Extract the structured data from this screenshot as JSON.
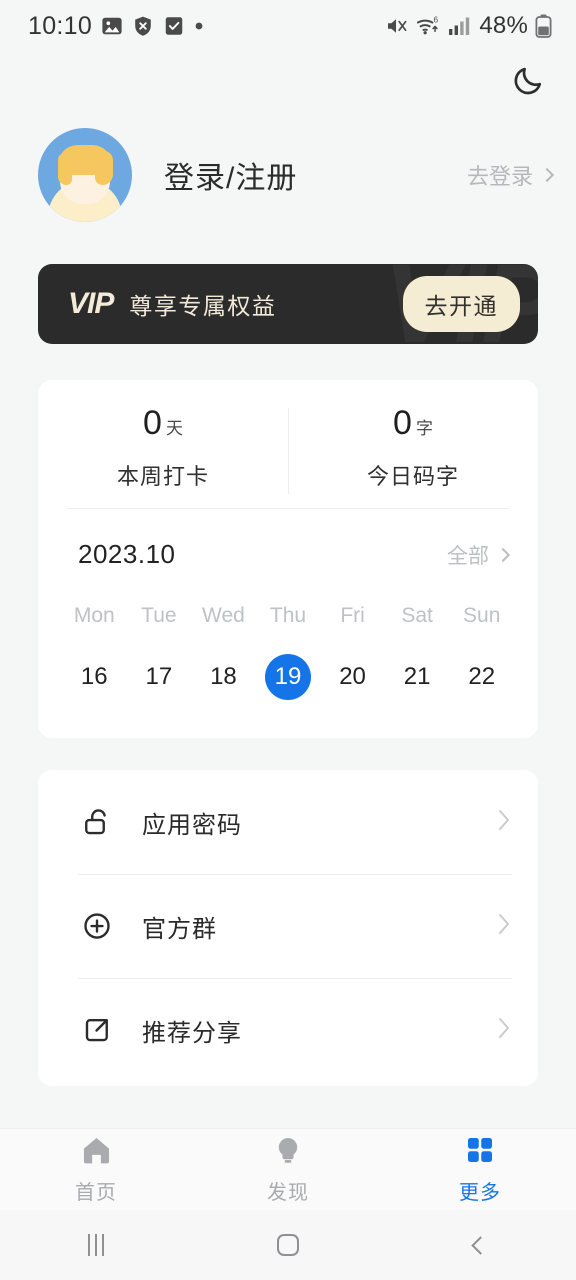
{
  "status_bar": {
    "time": "10:10",
    "left_icons": [
      "photo-icon",
      "shield-x-icon",
      "checkbox-icon",
      "dot-icon"
    ],
    "right_icons": [
      "mute-icon",
      "wifi6-icon",
      "signal-bars-icon"
    ],
    "battery_percent": "48%"
  },
  "header": {
    "dark_mode_icon": "moon-icon"
  },
  "profile": {
    "name": "登录/注册",
    "action_label": "去登录",
    "avatar": "user-avatar"
  },
  "vip_banner": {
    "logo": "VIP",
    "watermark": "VIP",
    "slogan": "尊享专属权益",
    "button_label": "去开通",
    "background_color": "#2b2b2b",
    "button_color": "#f5ecd4"
  },
  "stats": [
    {
      "value": "0",
      "unit": "天",
      "label": "本周打卡"
    },
    {
      "value": "0",
      "unit": "字",
      "label": "今日码字"
    }
  ],
  "calendar": {
    "month": "2023.10",
    "all_label": "全部",
    "weekdays": [
      "Mon",
      "Tue",
      "Wed",
      "Thu",
      "Fri",
      "Sat",
      "Sun"
    ],
    "days": [
      "16",
      "17",
      "18",
      "19",
      "20",
      "21",
      "22"
    ],
    "selected_index": 3,
    "selected_color": "#1575e8"
  },
  "menu": [
    {
      "icon": "unlock-icon",
      "label": "应用密码"
    },
    {
      "icon": "plus-circle-icon",
      "label": "官方群"
    },
    {
      "icon": "share-icon",
      "label": "推荐分享"
    }
  ],
  "tabbar": {
    "active_color": "#1575e8",
    "inactive_color": "#a9abae",
    "tabs": [
      {
        "icon": "home-icon",
        "label": "首页",
        "active": false
      },
      {
        "icon": "bulb-icon",
        "label": "发现",
        "active": false
      },
      {
        "icon": "grid-icon",
        "label": "更多",
        "active": true
      }
    ]
  },
  "system_nav": {
    "recents": "recents-icon",
    "home": "home-square-icon",
    "back": "back-icon"
  }
}
